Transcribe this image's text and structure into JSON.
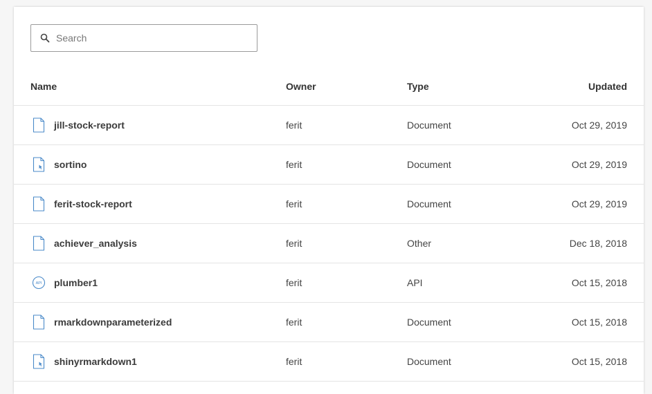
{
  "search": {
    "placeholder": "Search",
    "value": ""
  },
  "columns": {
    "name": "Name",
    "owner": "Owner",
    "type": "Type",
    "updated": "Updated"
  },
  "rows": [
    {
      "name": "jill-stock-report",
      "owner": "ferit",
      "type": "Document",
      "updated": "Oct 29, 2019",
      "icon": "document-icon"
    },
    {
      "name": "sortino",
      "owner": "ferit",
      "type": "Document",
      "updated": "Oct 29, 2019",
      "icon": "interactive-document-icon"
    },
    {
      "name": "ferit-stock-report",
      "owner": "ferit",
      "type": "Document",
      "updated": "Oct 29, 2019",
      "icon": "document-icon"
    },
    {
      "name": "achiever_analysis",
      "owner": "ferit",
      "type": "Other",
      "updated": "Dec 18, 2018",
      "icon": "document-icon"
    },
    {
      "name": "plumber1",
      "owner": "ferit",
      "type": "API",
      "updated": "Oct 15, 2018",
      "icon": "api-icon",
      "icon_text": "API"
    },
    {
      "name": "rmarkdownparameterized",
      "owner": "ferit",
      "type": "Document",
      "updated": "Oct 15, 2018",
      "icon": "document-icon"
    },
    {
      "name": "shinyrmarkdown1",
      "owner": "ferit",
      "type": "Document",
      "updated": "Oct 15, 2018",
      "icon": "interactive-document-icon"
    }
  ],
  "colors": {
    "icon_blue": "#4a8ac9",
    "border": "#e4e4e4",
    "text": "#333333"
  }
}
